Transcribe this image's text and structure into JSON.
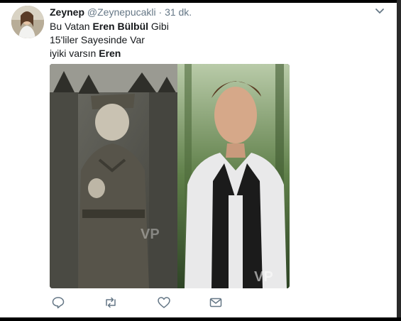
{
  "tweet": {
    "name": "Zeynep",
    "handle": "@Zeynepucakli",
    "separator": "·",
    "time": "31 dk.",
    "line1": {
      "pre": "Bu Vatan ",
      "bold": "Eren Bülbül",
      "post": " Gibi"
    },
    "line2": "15'liler Sayesinde Var",
    "line3": {
      "pre": "iyiki varsın ",
      "bold": "Eren"
    }
  },
  "media": {
    "watermark_left": "VP",
    "watermark_right": "VP"
  },
  "actions": {
    "reply_icon": "speech-bubble",
    "retweet_icon": "retweet-arrows",
    "like_icon": "heart-outline",
    "message_icon": "envelope"
  },
  "colors": {
    "text": "#14171a",
    "muted": "#657786",
    "icon": "#657786"
  }
}
